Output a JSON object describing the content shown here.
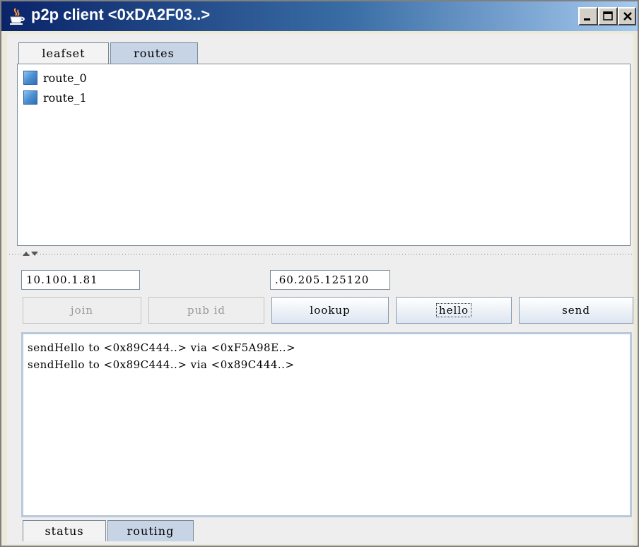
{
  "window": {
    "title": "p2p client <0xDA2F03..>",
    "icon": "java-cup-icon",
    "controls": {
      "minimize": "minimize-icon",
      "maximize": "maximize-icon",
      "close": "close-icon"
    }
  },
  "top_tabs": [
    {
      "label": "leafset",
      "selected": false
    },
    {
      "label": "routes",
      "selected": true
    }
  ],
  "routes_list": [
    {
      "label": "route_0",
      "icon": "file-icon"
    },
    {
      "label": "route_1",
      "icon": "file-icon"
    }
  ],
  "inputs": {
    "bootstrap_address": "10.100.1.81",
    "target_address": ".60.205.125120"
  },
  "buttons": {
    "join": "join",
    "pub_id": "pub id",
    "lookup": "lookup",
    "hello": "hello",
    "send": "send"
  },
  "log_lines": [
    "sendHello to <0x89C444..> via <0xF5A98E..>",
    "sendHello to <0x89C444..> via <0x89C444..>"
  ],
  "bottom_tabs": [
    {
      "label": "status",
      "selected": false
    },
    {
      "label": "routing",
      "selected": true
    }
  ],
  "colors": {
    "title_start": "#0a246a",
    "title_end": "#a6caf0",
    "tab_active": "#c6d4e5",
    "border": "#7a8a99"
  }
}
